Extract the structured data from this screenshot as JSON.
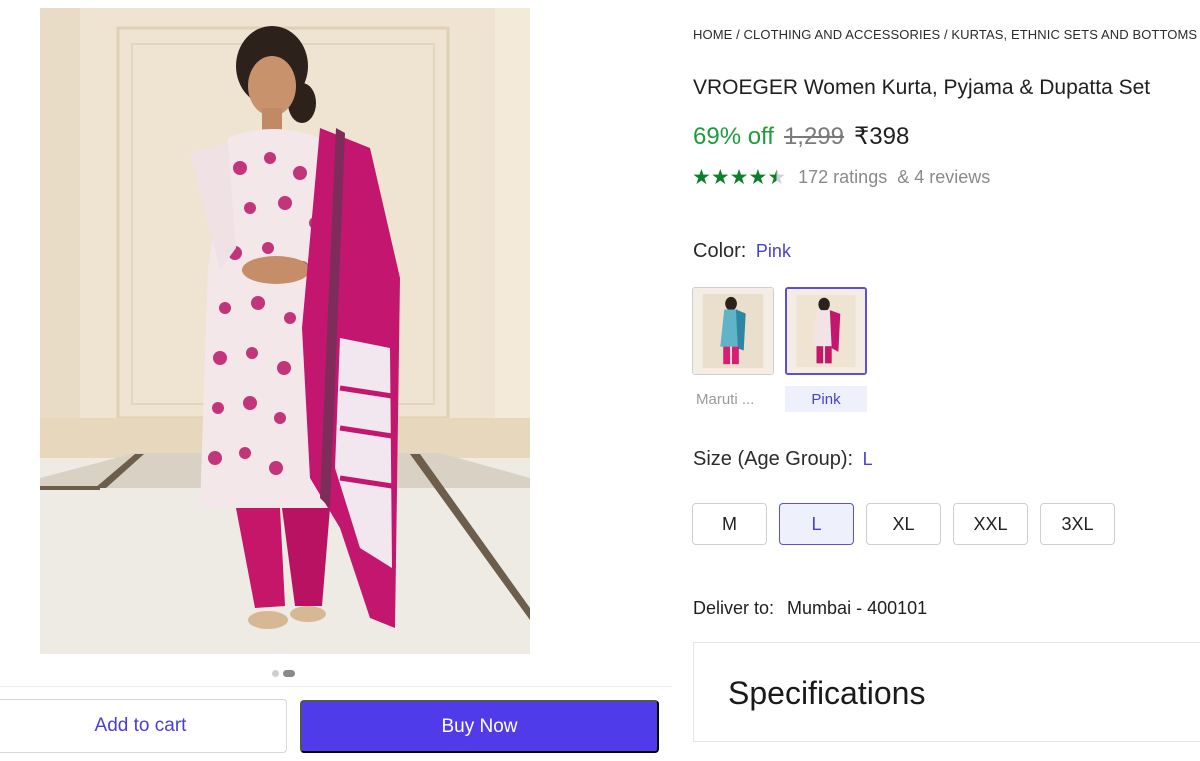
{
  "breadcrumb": "HOME / CLOTHING AND ACCESSORIES / KURTAS, ETHNIC SETS AND BOTTOMS",
  "product": {
    "title": "VROEGER Women Kurta, Pyjama & Dupatta Set",
    "discount": "69% off",
    "mrp": "1,299",
    "price": "₹398",
    "rating_value": 4.5,
    "ratings_text": "172 ratings",
    "reviews_text": "& 4 reviews"
  },
  "color": {
    "label": "Color:",
    "selected": "Pink",
    "options": [
      {
        "caption": "Maruti ...",
        "selected": false
      },
      {
        "caption": "Pink",
        "selected": true
      }
    ]
  },
  "size": {
    "label": "Size (Age Group):",
    "selected": "L",
    "options": [
      "M",
      "L",
      "XL",
      "XXL",
      "3XL"
    ]
  },
  "delivery": {
    "label": "Deliver to:",
    "location": "Mumbai - 400101"
  },
  "specifications": {
    "title": "Specifications"
  },
  "actions": {
    "add_to_cart": "Add to cart",
    "buy_now": "Buy Now"
  },
  "gallery": {
    "active_index": 1,
    "count": 2
  },
  "colors": {
    "accent": "#4f3bea",
    "discount_green": "#1e9c3a",
    "star_green": "#0b7f2a"
  }
}
